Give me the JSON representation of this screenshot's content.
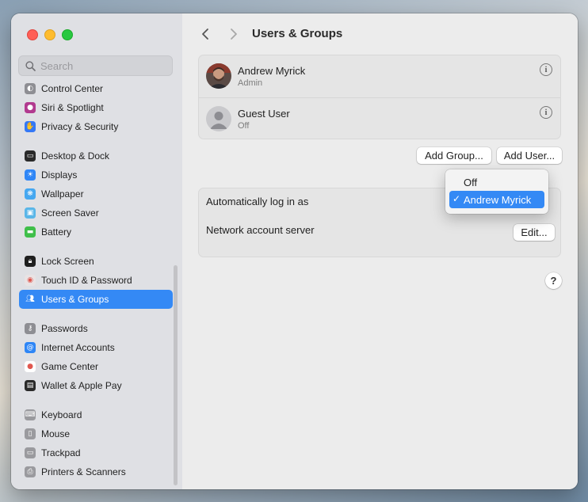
{
  "window": {
    "title": "Users & Groups"
  },
  "sidebar": {
    "search_placeholder": "Search",
    "groups": [
      [
        {
          "label": "Control Center",
          "icon": "control-center-icon",
          "color": "#8e8e93",
          "glyph": "◐"
        },
        {
          "label": "Siri & Spotlight",
          "icon": "siri-icon",
          "color": "#b23a8f",
          "glyph": "●"
        },
        {
          "label": "Privacy & Security",
          "icon": "hand-icon",
          "color": "#3478f6",
          "glyph": "✋"
        }
      ],
      [
        {
          "label": "Desktop & Dock",
          "icon": "dock-icon",
          "color": "#2a2a2a",
          "glyph": "▭"
        },
        {
          "label": "Displays",
          "icon": "displays-icon",
          "color": "#2f86f6",
          "glyph": "☀"
        },
        {
          "label": "Wallpaper",
          "icon": "wallpaper-icon",
          "color": "#45a7f0",
          "glyph": "❋"
        },
        {
          "label": "Screen Saver",
          "icon": "screen-saver-icon",
          "color": "#5ab6e8",
          "glyph": "▣"
        },
        {
          "label": "Battery",
          "icon": "battery-icon",
          "color": "#3fbf4a",
          "glyph": "▬"
        }
      ],
      [
        {
          "label": "Lock Screen",
          "icon": "lock-icon",
          "color": "#1f1f1f",
          "glyph": "🔒︎"
        },
        {
          "label": "Touch ID & Password",
          "icon": "fingerprint-icon",
          "color": "#e9e3e4",
          "glyph": "◉"
        },
        {
          "label": "Users & Groups",
          "icon": "users-icon",
          "color": "#3478f6",
          "glyph": "👥︎",
          "active": true
        }
      ],
      [
        {
          "label": "Passwords",
          "icon": "key-icon",
          "color": "#8e8e93",
          "glyph": "⚷"
        },
        {
          "label": "Internet Accounts",
          "icon": "at-icon",
          "color": "#2f86f6",
          "glyph": "@"
        },
        {
          "label": "Game Center",
          "icon": "game-center-icon",
          "color": "#ffffff",
          "glyph": "●"
        },
        {
          "label": "Wallet & Apple Pay",
          "icon": "wallet-icon",
          "color": "#2a2a2a",
          "glyph": "▤"
        }
      ],
      [
        {
          "label": "Keyboard",
          "icon": "keyboard-icon",
          "color": "#9a9a9e",
          "glyph": "⌨"
        },
        {
          "label": "Mouse",
          "icon": "mouse-icon",
          "color": "#9a9a9e",
          "glyph": "▯"
        },
        {
          "label": "Trackpad",
          "icon": "trackpad-icon",
          "color": "#9a9a9e",
          "glyph": "▭"
        },
        {
          "label": "Printers & Scanners",
          "icon": "printer-icon",
          "color": "#9a9a9e",
          "glyph": "⎙"
        }
      ]
    ]
  },
  "users": [
    {
      "name": "Andrew Myrick",
      "role": "Admin",
      "avatar": "photo"
    },
    {
      "name": "Guest User",
      "role": "Off",
      "avatar": "guest"
    }
  ],
  "buttons": {
    "add_group": "Add Group...",
    "add_user": "Add User...",
    "edit": "Edit...",
    "help": "?"
  },
  "settings": {
    "auto_login_label": "Automatically log in as",
    "network_label": "Network account server"
  },
  "auto_login_menu": {
    "options": [
      "Off",
      "Andrew Myrick"
    ],
    "selected": "Andrew Myrick"
  },
  "colors": {
    "accent": "#3489f5"
  }
}
